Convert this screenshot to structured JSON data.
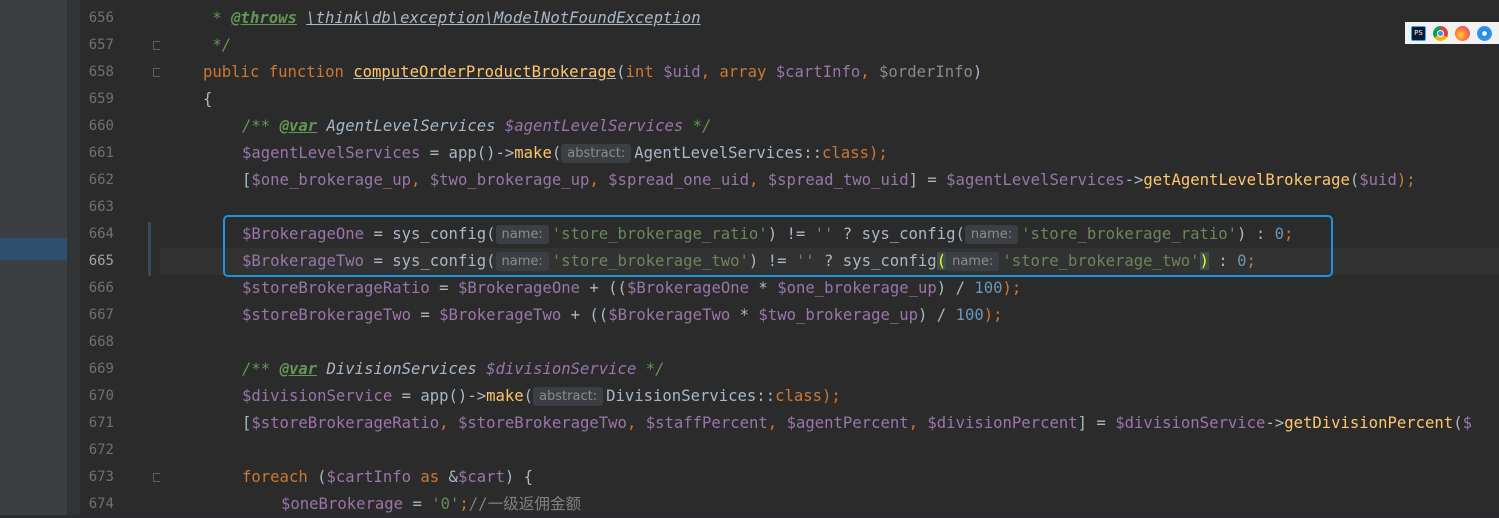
{
  "gutter": {
    "line_numbers": [
      "656",
      "657",
      "658",
      "659",
      "660",
      "661",
      "662",
      "663",
      "664",
      "665",
      "666",
      "667",
      "668",
      "669",
      "670",
      "671",
      "672",
      "673",
      "674"
    ],
    "current_line": "665"
  },
  "code": {
    "l656": {
      "star": " * ",
      "tag": "@throws",
      "ref": "\\think\\db\\exception\\ModelNotFoundException"
    },
    "l657": {
      "text": " */"
    },
    "l658": {
      "public": "public",
      "function": "function",
      "name": "computeOrderProductBrokerage",
      "open": "(",
      "int": "int",
      "p1": "$uid",
      "c1": ", ",
      "array": "array",
      "p2": "$cartInfo",
      "c2": ", ",
      "p3": "$orderInfo",
      "close": ")"
    },
    "l659": {
      "text": "{"
    },
    "l660": {
      "open": "/** ",
      "tag": "@var",
      "type": " AgentLevelServices ",
      "var": "$agentLevelServices",
      "close": " */"
    },
    "l661": {
      "var": "$agentLevelServices",
      "op": " = app()->",
      "fn": "make",
      "open": "(",
      "hint": "abstract:",
      "cls": "AgentLevelServices::",
      "kw": "class",
      "end": ");"
    },
    "l662": {
      "open": "[",
      "v1": "$one_brokerage_up",
      "v2": "$two_brokerage_up",
      "v3": "$spread_one_uid",
      "v4": "$spread_two_uid",
      "comma": ", ",
      "mid": "] = ",
      "v5": "$agentLevelServices",
      "arrow": "->",
      "fn": "getAgentLevelBrokerage",
      "popen": "(",
      "v6": "$uid",
      "end": ");"
    },
    "l664": {
      "var": "$BrokerageOne",
      "eq": " = sys_config(",
      "hint1": "name:",
      "str1": "'store_brokerage_ratio'",
      "ne": ") != ",
      "empty": "''",
      "q": " ? sys_config(",
      "hint2": "name:",
      "str2": "'store_brokerage_ratio'",
      "colon": ") : ",
      "zero": "0",
      "semi": ";"
    },
    "l665": {
      "var": "$BrokerageTwo",
      "eq": " = sys_config(",
      "hint1": "name:",
      "str1": "'store_brokerage_two'",
      "ne": ") != ",
      "empty": "''",
      "q": " ? sys_config",
      "pl": "(",
      "hint2": "name:",
      "str2": "'store_brokerage_two'",
      "pr": ")",
      "colon": " : ",
      "zero": "0",
      "semi": ";"
    },
    "l666": {
      "v1": "$storeBrokerageRatio",
      "eq": " = ",
      "v2": "$BrokerageOne",
      "mid": " + ((",
      "v3": "$BrokerageOne",
      "mul": " * ",
      "v4": "$one_brokerage_up",
      "div": ") / ",
      "num": "100",
      "end": ");"
    },
    "l667": {
      "v1": "$storeBrokerageTwo",
      "eq": " = ",
      "v2": "$BrokerageTwo",
      "mid": " + ((",
      "v3": "$BrokerageTwo",
      "mul": " * ",
      "v4": "$two_brokerage_up",
      "div": ") / ",
      "num": "100",
      "end": ");"
    },
    "l669": {
      "open": "/** ",
      "tag": "@var",
      "type": " DivisionServices ",
      "var": "$divisionService",
      "close": " */"
    },
    "l670": {
      "var": "$divisionService",
      "op": " = app()->",
      "fn": "make",
      "open": "(",
      "hint": "abstract:",
      "cls": "DivisionServices::",
      "kw": "class",
      "end": ");"
    },
    "l671": {
      "open": "[",
      "v1": "$storeBrokerageRatio",
      "v2": "$storeBrokerageTwo",
      "v3": "$staffPercent",
      "v4": "$agentPercent",
      "v5": "$divisionPercent",
      "comma": ", ",
      "mid": "] = ",
      "v6": "$divisionService",
      "arrow": "->",
      "fn": "getDivisionPercent",
      "popen": "(",
      "tail": "$"
    },
    "l673": {
      "kw": "foreach",
      "open": " (",
      "v1": "$cartInfo",
      "as": "as",
      "amp": " &",
      "v2": "$cart",
      "close": ") {"
    },
    "l674": {
      "var": "$oneBrokerage",
      "eq": " = ",
      "str": "'0'",
      "semi": ";",
      "comment": "//一级返佣金额"
    }
  },
  "tray": {
    "icons": [
      "photoshop-icon",
      "chrome-icon",
      "firefox-icon",
      "safari-icon"
    ],
    "ps_label": "PS"
  },
  "colors": {
    "highlight_border": "#1a95d8",
    "keyword": "#cc7832",
    "function": "#ffc66d",
    "variable": "#9876aa",
    "string": "#6a8759",
    "number": "#6897bb"
  }
}
